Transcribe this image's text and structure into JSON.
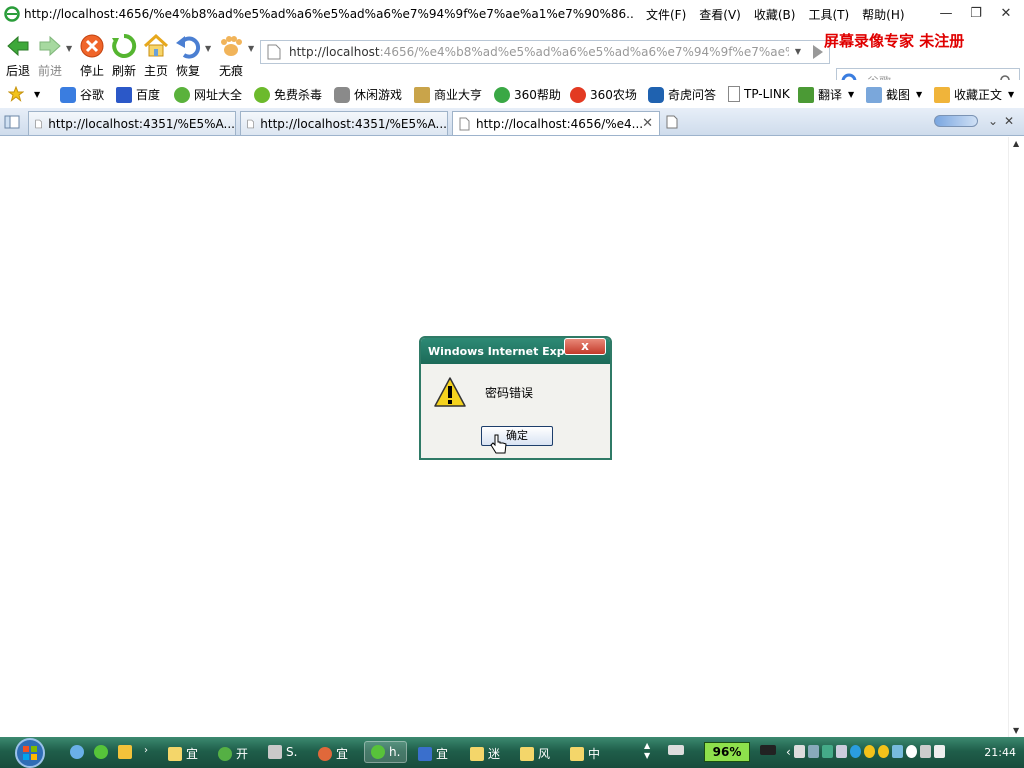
{
  "window": {
    "title": "http://localhost:4656/%e4%b8%ad%e5%ad%a6%e5%ad%a6%e7%94%9f%e7%ae%a1%e7%90%86..."
  },
  "menu": [
    "文件(F)",
    "查看(V)",
    "收藏(B)",
    "工具(T)",
    "帮助(H)"
  ],
  "toolbar": {
    "back": "后退",
    "forward": "前进",
    "stop": "停止",
    "refresh": "刷新",
    "home": "主页",
    "restore": "恢复",
    "incognito": "无痕"
  },
  "address": {
    "host": "http://localhost",
    "path": ":4656/%e4%b8%ad%e5%ad%a6%e5%ad%a6%e7%94%9f%e7%ae%a"
  },
  "watermark": "屏幕录像专家  未注册",
  "search": {
    "placeholder": "谷歌"
  },
  "favorites": [
    "谷歌",
    "百度",
    "网址大全",
    "免费杀毒",
    "休闲游戏",
    "商业大亨",
    "360帮助",
    "360农场",
    "奇虎问答",
    "TP-LINK",
    "翻译",
    "截图",
    "收藏正文"
  ],
  "tabs": [
    {
      "label": "http://localhost:4351/%E5%A..."
    },
    {
      "label": "http://localhost:4351/%E5%A..."
    },
    {
      "label": "http://localhost:4656/%e4..."
    }
  ],
  "dialog": {
    "title": "Windows Internet Expl...",
    "message": "密码错误",
    "ok_label": "确定",
    "close_label": "x"
  },
  "taskbar": {
    "items": [
      "宜",
      "开",
      "S.",
      "宜",
      "h.",
      "宜",
      "迷",
      "风",
      "中"
    ],
    "battery_pct": "96%",
    "clock": "21:44"
  }
}
